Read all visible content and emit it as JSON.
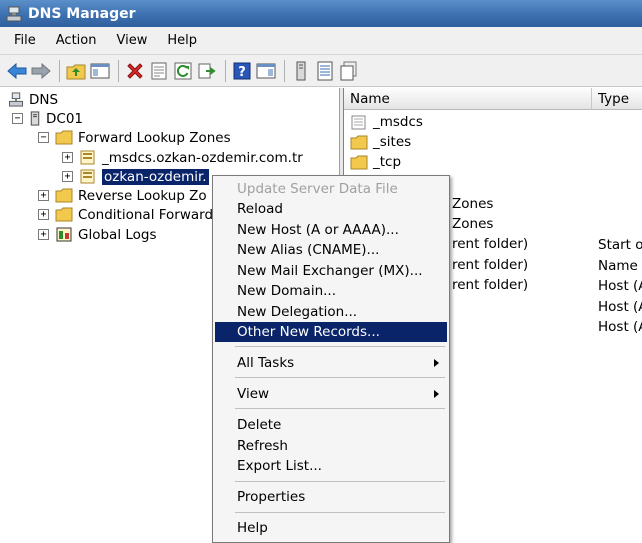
{
  "window": {
    "title": "DNS Manager"
  },
  "menubar": {
    "items": [
      "File",
      "Action",
      "View",
      "Help"
    ]
  },
  "toolbar": {
    "icons": [
      "back-arrow-icon",
      "forward-arrow-icon",
      "up-folder-icon",
      "show-hide-console-tree-icon",
      "delete-icon",
      "properties-icon",
      "refresh-icon",
      "export-list-icon",
      "help-icon",
      "show-hide-action-pane-icon",
      "server-icon",
      "list-view-icon",
      "copy-icon"
    ]
  },
  "tree": {
    "root": "DNS",
    "server": "DC01",
    "forward_zones": "Forward Lookup Zones",
    "zone_msdcs": "_msdcs.ozkan-ozdemir.com.tr",
    "zone_selected": "ozkan-ozdemir.",
    "reverse_zones": "Reverse Lookup Zo",
    "conditional_forwarders": "Conditional Forward",
    "global_logs": "Global Logs"
  },
  "list": {
    "columns": [
      "Name",
      "Type"
    ],
    "rows": [
      {
        "name": "_msdcs",
        "type": ""
      },
      {
        "name": "_sites",
        "type": ""
      },
      {
        "name": "_tcp",
        "type": ""
      },
      {
        "name": "Zones",
        "type": ""
      },
      {
        "name": "Zones",
        "type": ""
      },
      {
        "name": "rent folder)",
        "type": "Start o"
      },
      {
        "name": "rent folder)",
        "type": "Name S"
      },
      {
        "name": "rent folder)",
        "type": "Host (A"
      },
      {
        "name": "",
        "type": "Host (A"
      },
      {
        "name": "",
        "type": "Host (A"
      }
    ]
  },
  "context_menu": {
    "update": "Update Server Data File",
    "reload": "Reload",
    "new_host": "New Host (A or AAAA)...",
    "new_alias": "New Alias (CNAME)...",
    "new_mx": "New Mail Exchanger (MX)...",
    "new_domain": "New Domain...",
    "new_delegation": "New Delegation...",
    "other_records": "Other New Records...",
    "all_tasks": "All Tasks",
    "view": "View",
    "delete": "Delete",
    "refresh": "Refresh",
    "export": "Export List...",
    "properties": "Properties",
    "help": "Help"
  },
  "colors": {
    "titlebar": "#3f73b3",
    "selection": "#0a246a",
    "folder": "#f2c94c"
  }
}
